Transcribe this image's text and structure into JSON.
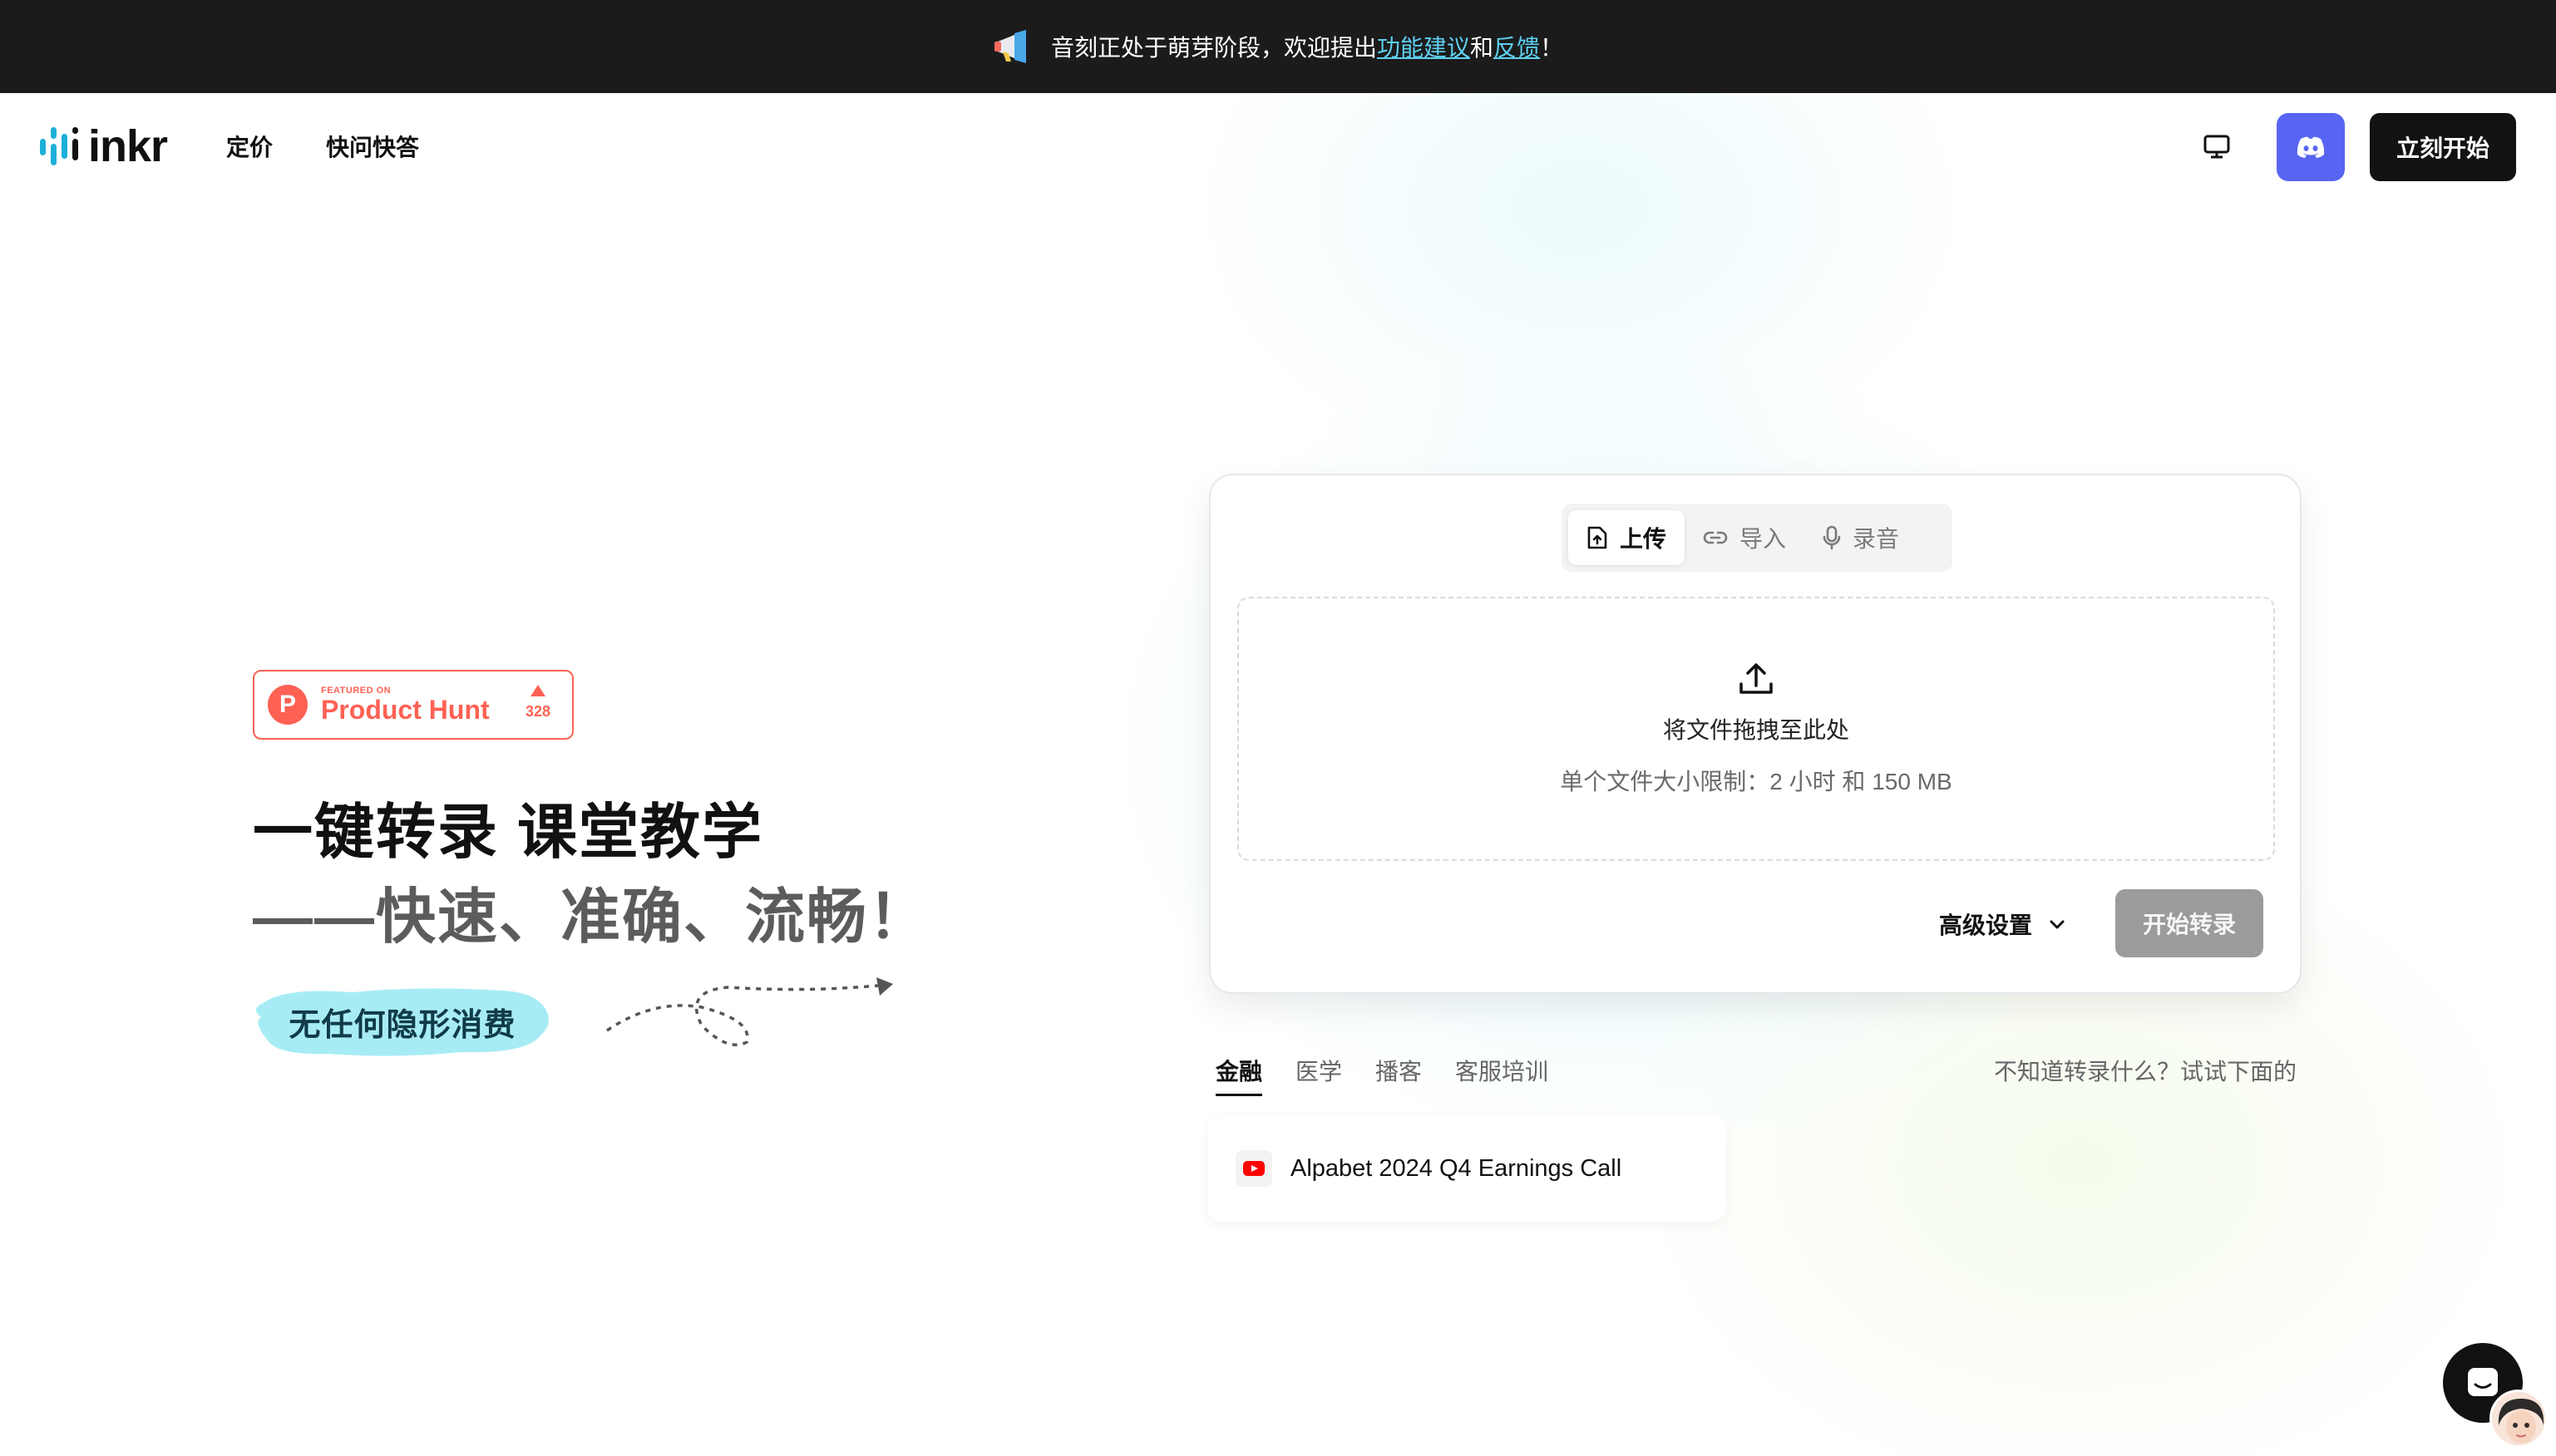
{
  "announcement": {
    "icon": "megaphone-icon",
    "prefix": "音刻正处于萌芽阶段，欢迎提出",
    "link1": "功能建议",
    "middle": "和",
    "link2": "反馈",
    "suffix": "！"
  },
  "nav": {
    "logo_text": "inkr",
    "links": [
      "定价",
      "快问快答"
    ],
    "monitor_icon": "monitor-icon",
    "discord_icon": "discord-icon",
    "start_label": "立刻开始"
  },
  "hero": {
    "badge": {
      "small": "FEATURED ON",
      "big": "Product Hunt",
      "votes": "328"
    },
    "line1": "一键转录 课堂教学",
    "line2": "——快速、准确、流畅！",
    "pill": "无任何隐形消费"
  },
  "upload": {
    "tabs": [
      {
        "label": "上传",
        "icon": "file-upload-icon",
        "active": true
      },
      {
        "label": "导入",
        "icon": "link-icon",
        "active": false
      },
      {
        "label": "录音",
        "icon": "microphone-icon",
        "active": false
      }
    ],
    "drop_title": "将文件拖拽至此处",
    "drop_limit": "单个文件大小限制：2 小时 和 150 MB",
    "advanced_label": "高级设置",
    "start_label": "开始转录"
  },
  "samples": {
    "categories": [
      "金融",
      "医学",
      "播客",
      "客服培训"
    ],
    "active_category": "金融",
    "hint": "不知道转录什么？试试下面的",
    "items": [
      {
        "title": "Alpabet 2024 Q4 Earnings Call",
        "icon": "youtube-icon"
      }
    ]
  },
  "colors": {
    "announcement_bg": "#1b1b1c",
    "link": "#5fd0ee",
    "brand": "#1bb0d8",
    "discord": "#5865f2",
    "product_hunt": "#ff6154",
    "pill": "#a7ecf5"
  }
}
